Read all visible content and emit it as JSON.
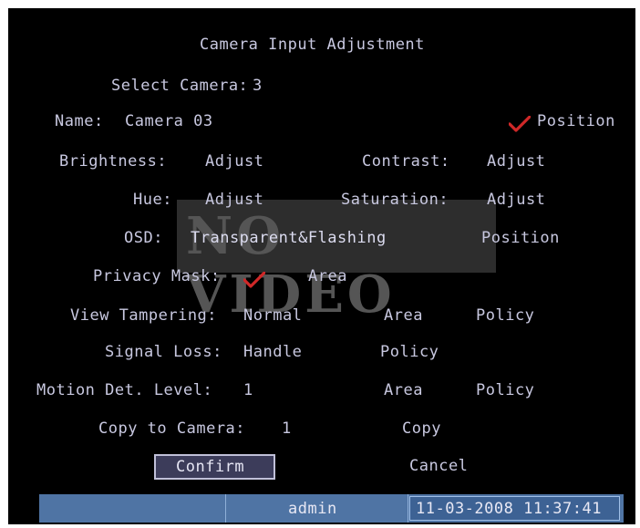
{
  "title": "Camera Input Adjustment",
  "select_camera": {
    "label": "Select Camera:",
    "value": "3"
  },
  "name": {
    "label": "Name:",
    "value": "Camera 03"
  },
  "position_top": {
    "label": "Position",
    "checked": true
  },
  "brightness": {
    "label": "Brightness:",
    "action": "Adjust"
  },
  "contrast": {
    "label": "Contrast:",
    "action": "Adjust"
  },
  "hue": {
    "label": "Hue:",
    "action": "Adjust"
  },
  "saturation": {
    "label": "Saturation:",
    "action": "Adjust"
  },
  "overlay": {
    "text": "NO VIDEO"
  },
  "osd": {
    "label": "OSD:",
    "value": "Transparent&Flashing",
    "position": "Position"
  },
  "privacy_mask": {
    "label": "Privacy Mask:",
    "checked": true,
    "area": "Area"
  },
  "view_tampering": {
    "label": "View Tampering:",
    "value": "Normal",
    "area": "Area",
    "policy": "Policy"
  },
  "signal_loss": {
    "label": "Signal Loss:",
    "value": "Handle",
    "policy": "Policy"
  },
  "motion_det": {
    "label": "Motion Det. Level:",
    "value": "1",
    "area": "Area",
    "policy": "Policy"
  },
  "copy_to_camera": {
    "label": "Copy to Camera:",
    "value": "1",
    "copy": "Copy"
  },
  "buttons": {
    "confirm": "Confirm",
    "cancel": "Cancel"
  },
  "status": {
    "user": "admin",
    "datetime": "11-03-2008 11:37:41"
  },
  "colors": {
    "background": "#000000",
    "text": "#c8c8e0",
    "check": "#d02828",
    "statusbar": "#4f74a4"
  }
}
